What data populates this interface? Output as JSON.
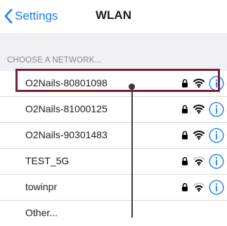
{
  "navbar": {
    "back_label": "Settings",
    "title": "WLAN"
  },
  "section_header": "CHOOSE A NETWORK...",
  "networks": [
    {
      "name": "O2Nails-80801098",
      "locked": true,
      "signal": "full"
    },
    {
      "name": "O2Nails-81000125",
      "locked": true,
      "signal": "full"
    },
    {
      "name": "O2Nails-90301483",
      "locked": true,
      "signal": "full"
    },
    {
      "name": "TEST_5G",
      "locked": true,
      "signal": "medium"
    },
    {
      "name": "towinpr",
      "locked": true,
      "signal": "medium"
    }
  ],
  "other_label": "Other...",
  "colors": {
    "accent": "#1a7cf5",
    "highlight": "#7b1f34",
    "grouped_background": "#efeff4"
  },
  "icons": [
    "chevron-left-icon",
    "lock-icon",
    "wifi-icon",
    "info-icon"
  ]
}
